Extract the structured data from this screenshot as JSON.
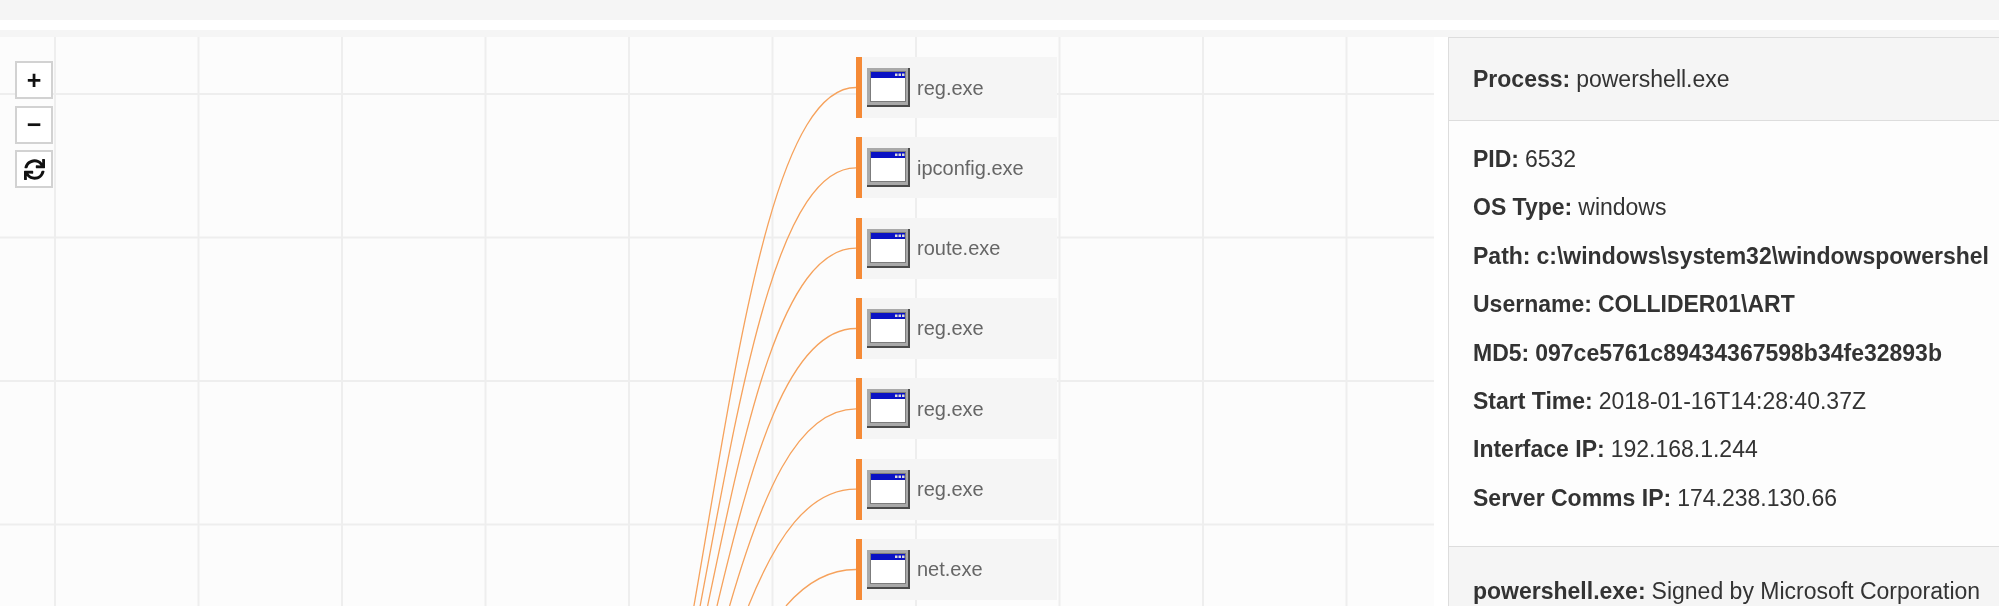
{
  "graph": {
    "controls": [
      {
        "kind": "zoom_in",
        "label": "+"
      },
      {
        "kind": "zoom_out",
        "label": "−"
      },
      {
        "kind": "reset"
      }
    ],
    "nodes": [
      {
        "name": "reg.exe"
      },
      {
        "name": "ipconfig.exe"
      },
      {
        "name": "route.exe"
      },
      {
        "name": "reg.exe"
      },
      {
        "name": "reg.exe"
      },
      {
        "name": "reg.exe"
      },
      {
        "name": "net.exe"
      }
    ]
  },
  "details": {
    "title": {
      "label": "Process:",
      "value": "powershell.exe"
    },
    "fields": [
      {
        "label": "PID:",
        "value": "6532",
        "bold": false
      },
      {
        "label": "OS Type:",
        "value": "windows",
        "bold": false
      },
      {
        "label": "Path:",
        "value": "c:\\windows\\system32\\windowspowershel",
        "bold": true
      },
      {
        "label": "Username:",
        "value": "COLLIDER01\\ART",
        "bold": true
      },
      {
        "label": "MD5:",
        "value": "097ce5761c89434367598b34fe32893b",
        "bold": true
      },
      {
        "label": "Start Time:",
        "value": "2018-01-16T14:28:40.37Z",
        "bold": false
      },
      {
        "label": "Interface IP:",
        "value": "192.168.1.244",
        "bold": false
      },
      {
        "label": "Server Comms IP:",
        "value": "174.238.130.66",
        "bold": false
      }
    ],
    "signature": {
      "label": "powershell.exe:",
      "value": "Signed by Microsoft Corporation"
    }
  }
}
